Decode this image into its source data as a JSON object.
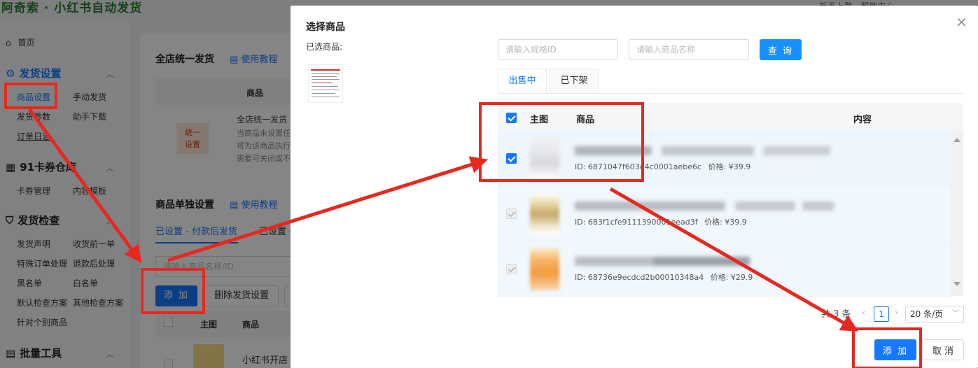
{
  "app": {
    "title": "阿奇索 · 小红书自动发货",
    "topbar_text": "新手上路 · 帮助中心"
  },
  "sidebar": {
    "home": "首页",
    "groups": [
      {
        "label": "发货设置",
        "items": [
          "商品设置",
          "手动发货",
          "发货参数",
          "助手下载",
          "订单日志"
        ]
      },
      {
        "label": "91卡券仓库",
        "items": [
          "卡券管理",
          "内容模板"
        ]
      },
      {
        "label": "发货检查",
        "items": [
          "发货声明",
          "收货前一单",
          "特殊订单处理",
          "退款后处理",
          "黑名单",
          "白名单",
          "默认检查方案",
          "其他检查方案",
          "针对个别商品"
        ]
      },
      {
        "label": "批量工具",
        "items": []
      }
    ]
  },
  "main": {
    "store_section_title": "全店统一发货",
    "help_link": "使用教程",
    "col_product": "商品",
    "badge": "统一\n设置",
    "store_desc": [
      "全店统一发货",
      "当商品未设置任",
      "将为该商品执行",
      "需要可关闭或不"
    ],
    "single_section_title": "商品单独设置",
    "tab_set": "已设置 - 付款后发货",
    "tab_set2": "已设置 -",
    "search_placeholder": "请输入商品名称/ID",
    "add_button": "添 加",
    "delete_button": "删除发货设置",
    "col_image": "主图",
    "row_text": "小红书开店"
  },
  "modal": {
    "title": "选择商品",
    "selected_label": "已选商品:",
    "spec_id_placeholder": "请输入规格ID",
    "name_placeholder": "请输入商品名称",
    "query_button": "查 询",
    "tabs": [
      "出售中",
      "已下架"
    ],
    "columns": {
      "image": "主图",
      "product": "商品",
      "content": "内容"
    },
    "rows": [
      {
        "id_label": "ID: 6871047f603d4c0001aebe6c",
        "price_label": "价格: ¥39.9",
        "state": "checked"
      },
      {
        "id_label": "ID: 683f1cfe9111390001eead3f",
        "price_label": "价格: ¥39.9",
        "state": "disabled"
      },
      {
        "id_label": "ID: 68736e9ecdcd2b00010348a4",
        "price_label": "价格: ¥29.9",
        "state": "disabled"
      }
    ],
    "pager": {
      "total": "共 3 条",
      "page": "1",
      "page_size": "20 条/页"
    },
    "add_button": "添 加",
    "cancel_button": "取 消"
  },
  "colors": {
    "primary": "#1677ff",
    "annotation": "#e8281e",
    "brand_green": "#2e7d32"
  }
}
